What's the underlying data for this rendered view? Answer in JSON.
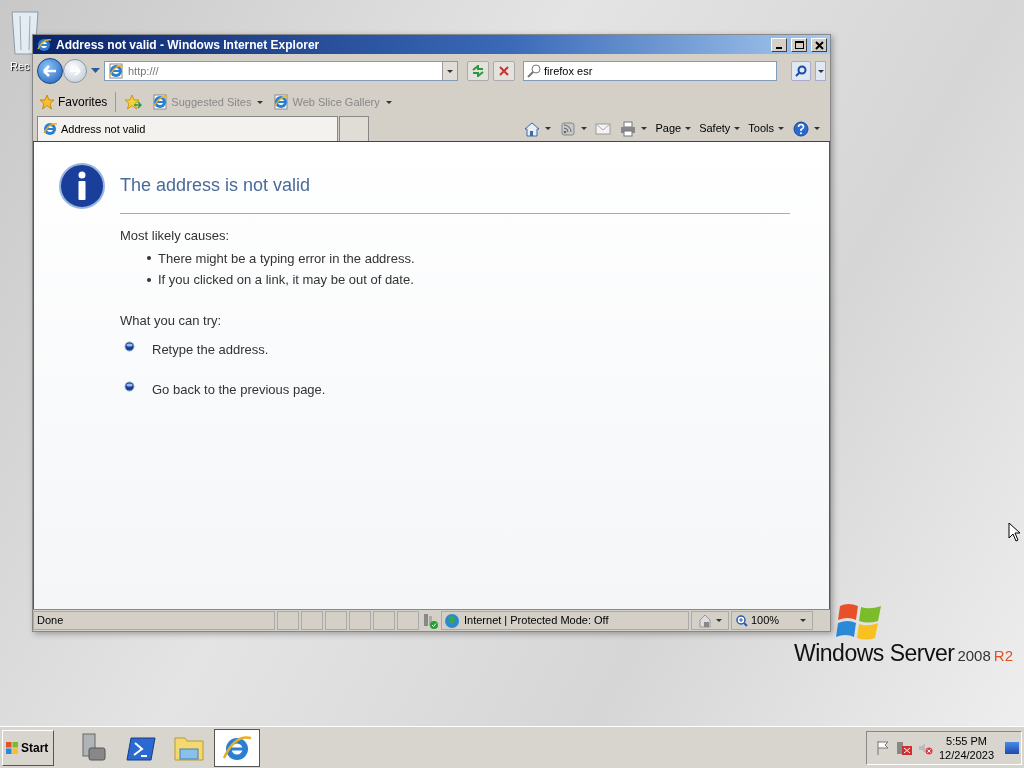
{
  "desktop": {
    "icons": [
      {
        "label": "Rec"
      }
    ]
  },
  "window": {
    "title": "Address not valid - Windows Internet Explorer",
    "address": "http:///",
    "search": "firefox esr",
    "favorites": {
      "label": "Favorites",
      "links": [
        "Suggested Sites",
        "Web Slice Gallery"
      ]
    },
    "tabs": [
      {
        "label": "Address not valid",
        "selected": true
      }
    ],
    "command_bar": [
      "Page",
      "Safety",
      "Tools"
    ],
    "content": {
      "heading": "The address is not valid",
      "causes_label": "Most likely causes:",
      "causes": [
        "There might be a typing error in the address.",
        "If you clicked on a link, it may be out of date."
      ],
      "try_label": "What you can try:",
      "try": [
        "Retype the address.",
        "Go back to the previous page."
      ]
    },
    "status_bar": {
      "status": "Done",
      "zone": "Internet | Protected Mode: Off",
      "zoom": "100%"
    }
  },
  "logo": {
    "name": "Windows Server",
    "version": "2008",
    "edition": "R2"
  },
  "taskbar": {
    "start": "Start",
    "apps": [
      {
        "kind": "server-manager",
        "selected": false
      },
      {
        "kind": "powershell",
        "selected": false
      },
      {
        "kind": "explorer",
        "selected": false
      },
      {
        "kind": "browser",
        "selected": true
      }
    ],
    "clock": {
      "time": "5:55 PM",
      "date": "12/24/2023"
    }
  }
}
